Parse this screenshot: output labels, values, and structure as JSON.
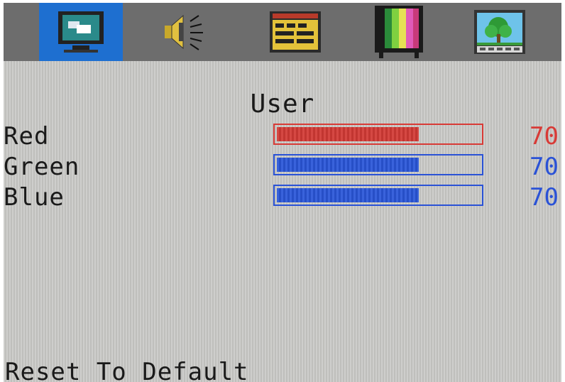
{
  "tabs": [
    {
      "icon": "monitor-icon",
      "active": true
    },
    {
      "icon": "speaker-icon",
      "active": false
    },
    {
      "icon": "menu-panel-icon",
      "active": false
    },
    {
      "icon": "color-bars-icon",
      "active": false
    },
    {
      "icon": "landscape-picture-icon",
      "active": false
    }
  ],
  "section_title": "User",
  "rows": [
    {
      "label": "Red",
      "value": "70",
      "level_percent": 70,
      "color": "#d83a36"
    },
    {
      "label": "Green",
      "value": "70",
      "level_percent": 70,
      "color": "#2a52d6"
    },
    {
      "label": "Blue",
      "value": "70",
      "level_percent": 70,
      "color": "#2a52d6"
    }
  ],
  "footer_action": "Reset To Default",
  "colors": {
    "active_tab": "#1e6fd0",
    "tab_bar": "#6d6d6d",
    "background": "#c9c9c6"
  }
}
